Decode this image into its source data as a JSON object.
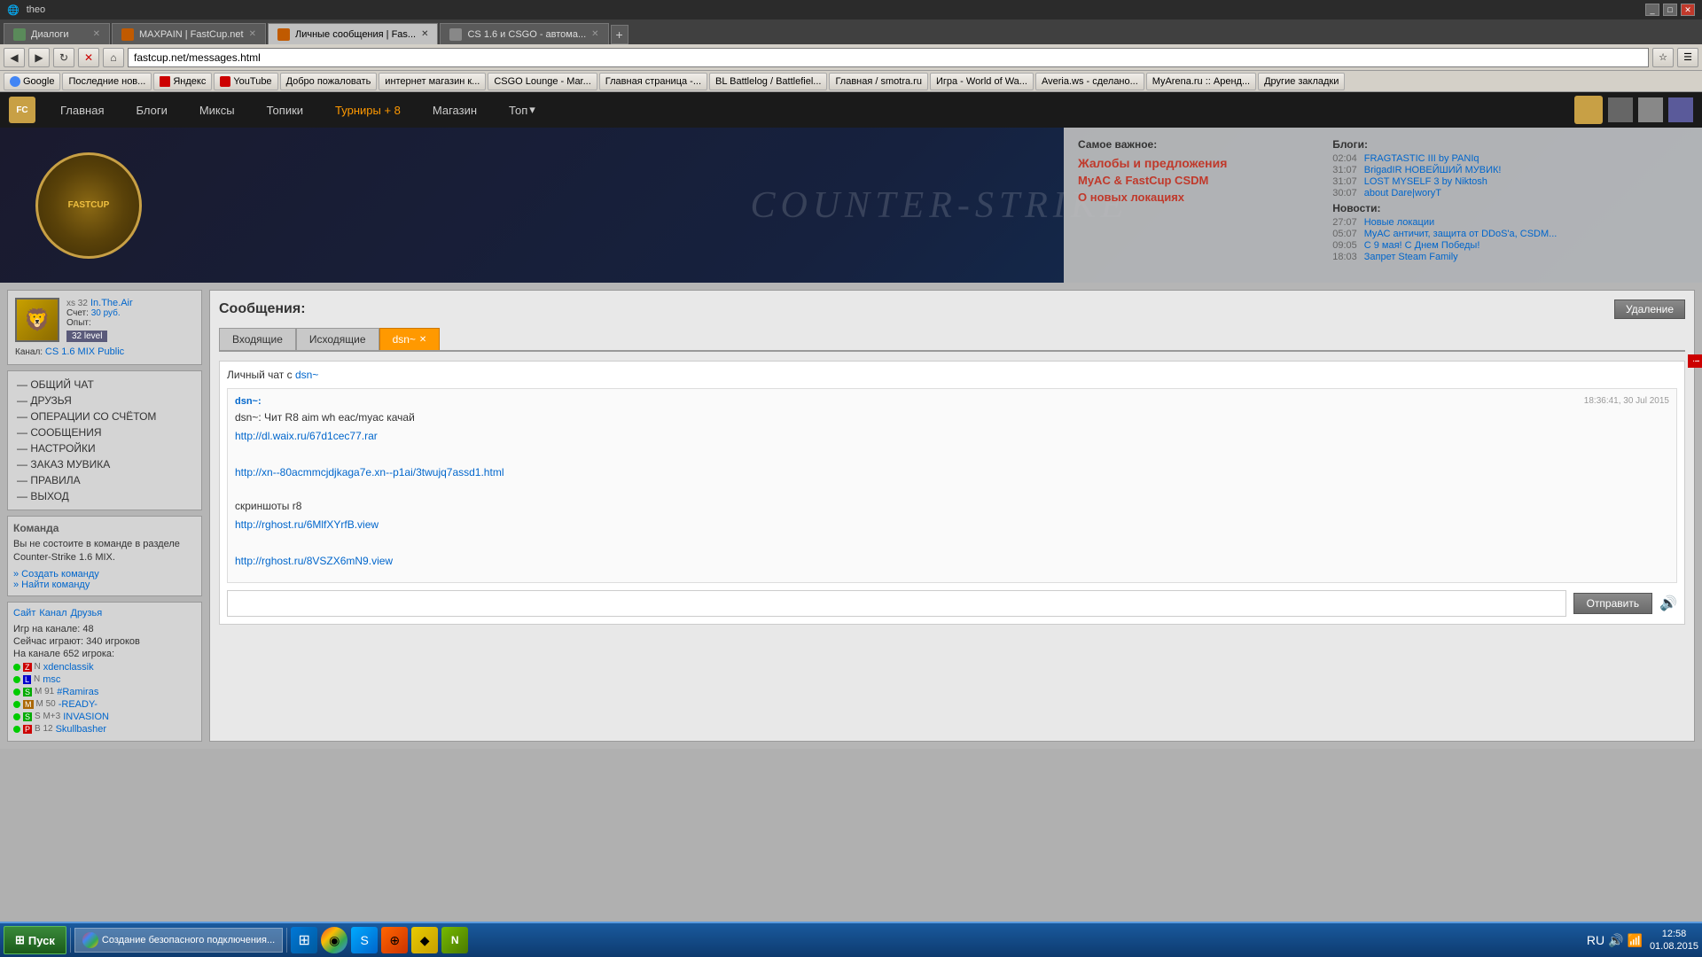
{
  "browser": {
    "title": "theo",
    "tabs": [
      {
        "id": "tab1",
        "label": "Диалоги",
        "active": false,
        "favicon": "💬"
      },
      {
        "id": "tab2",
        "label": "MAXPAIN | FastCup.net",
        "active": false,
        "favicon": "🎮"
      },
      {
        "id": "tab3",
        "label": "Личные сообщения | Fas...",
        "active": true,
        "favicon": "✉"
      },
      {
        "id": "tab4",
        "label": "CS 1.6 и CSGO - автома...",
        "active": false,
        "favicon": "🎯"
      }
    ],
    "address": "fastcup.net/messages.html",
    "bookmarks": [
      {
        "label": "Google"
      },
      {
        "label": "Последние нов..."
      },
      {
        "label": "Яндекс"
      },
      {
        "label": "YouTube"
      },
      {
        "label": "Добро пожаловать"
      },
      {
        "label": "интернет магазин к..."
      },
      {
        "label": "CSGO Lounge - Mar..."
      },
      {
        "label": "Главная страница -..."
      },
      {
        "label": "BL  Battlelog / Battlefiel..."
      },
      {
        "label": "Главная / smotra.ru"
      },
      {
        "label": "Игра - World of Wa..."
      },
      {
        "label": "Averia.ws - сделано..."
      },
      {
        "label": "MyArena.ru :: Аренд..."
      },
      {
        "label": "Другие закладки"
      }
    ]
  },
  "site": {
    "nav": {
      "items": [
        {
          "label": "Главная"
        },
        {
          "label": "Блоги"
        },
        {
          "label": "Миксы"
        },
        {
          "label": "Топики"
        },
        {
          "label": "Турниры + 8"
        },
        {
          "label": "Магазин"
        },
        {
          "label": "Топ"
        }
      ]
    },
    "banner": {
      "title": "Counter-Strike",
      "logo_text": "FASTCUP"
    },
    "important": {
      "title": "Самое важное:",
      "links": [
        {
          "label": "Жалобы и предложения"
        },
        {
          "label": "MyAC & FastCup CSDM"
        },
        {
          "label": "О новых локациях"
        }
      ]
    },
    "blogs": {
      "title": "Блоги:",
      "items": [
        {
          "time": "02:04",
          "label": "FRAGTASTIC III by PANIq"
        },
        {
          "time": "31:07",
          "label": "BrigadIR НОВЕЙШИЙ МУВИК!"
        },
        {
          "time": "31:07",
          "label": "LOST MYSELF 3 by Niktosh"
        },
        {
          "time": "30:07",
          "label": "about Dare|woryT"
        }
      ]
    },
    "news": {
      "title": "Новости:",
      "items": [
        {
          "time": "27:07",
          "label": "Новые локации"
        },
        {
          "time": "05:07",
          "label": "MyАС античит, защита от DDoS'а, CSDM..."
        },
        {
          "time": "09:05",
          "label": "С 9 мая! С Днем Победы!"
        },
        {
          "time": "18:03",
          "label": "Запрет Steam Family"
        }
      ]
    }
  },
  "sidebar": {
    "user": {
      "name": "In.The.Air",
      "prefix": "xs 32",
      "score": "30 руб.",
      "exp_label": "Опыт:",
      "level": "32 level",
      "channel_label": "Канал:",
      "channel": "CS 1.6 MIX Public"
    },
    "menu_items": [
      {
        "label": "— ОБЩИЙ ЧАТ"
      },
      {
        "label": "— ДРУЗЬЯ"
      },
      {
        "label": "— ОПЕРАЦИИ СО СЧЁТОМ"
      },
      {
        "label": "— СООБЩЕНИЯ"
      },
      {
        "label": "— НАСТРОЙКИ"
      },
      {
        "label": "— ЗАКАЗ МУВИКА"
      },
      {
        "label": "— ПРАВИЛА"
      },
      {
        "label": "— ВЫХОД"
      }
    ],
    "team": {
      "title": "Команда",
      "text": "Вы не состоите в команде в разделе Counter-Strike 1.6 MIX.",
      "create_link": "» Создать команду",
      "find_link": "» Найти команду"
    },
    "channel": {
      "tabs": [
        "Сайт",
        "Канал",
        "Друзья"
      ],
      "stats": [
        {
          "label": "Игр на канале: 48"
        },
        {
          "label": "Сейчас играют: 340 игроков"
        },
        {
          "label": "На канале 652 игрока:"
        }
      ],
      "players": [
        {
          "rank": "Z",
          "rank_class": "rank-z",
          "prefix": "N",
          "name": "xdenclassik"
        },
        {
          "rank": "L",
          "rank_class": "rank-l",
          "prefix": "N",
          "name": "msc"
        },
        {
          "rank": "S",
          "rank_class": "rank-s",
          "prefix": "M 91",
          "name": "#Ramiras"
        },
        {
          "rank": "M",
          "rank_class": "rank-m",
          "prefix": "M 50",
          "name": "-READY-"
        },
        {
          "rank": "S",
          "rank_class": "rank-s",
          "prefix": "S M+3",
          "name": "INVASION"
        },
        {
          "rank": "P",
          "rank_class": "rank-p",
          "prefix": "B 12",
          "name": "Skullbasher"
        }
      ]
    }
  },
  "messages": {
    "page_title": "Сообщения:",
    "delete_btn": "Удаление",
    "tabs": [
      {
        "label": "Входящие",
        "active": false
      },
      {
        "label": "Исходящие",
        "active": false
      },
      {
        "label": "dsn~",
        "active": true,
        "closeable": true
      }
    ],
    "chat_title_prefix": "Личный чат с",
    "chat_user": "dsn~",
    "messages": [
      {
        "sender": "dsn~:",
        "text": "dsn~: Чит R8 aim wh eac/myac качай",
        "timestamp": "18:36:41, 30 Jul 2015",
        "links": [
          "http://dl.waix.ru/67d1cec77.rar",
          "http://xn--80acmmcjdjkaga7e.xn--p1ai/3twujq7assd1.html",
          "",
          "скриншоты r8",
          "",
          "http://rghost.ru/6MlfXYrfB.view",
          "",
          "http://rghost.ru/8VSZX6mN9.view"
        ]
      }
    ],
    "input_placeholder": "",
    "send_btn": "Отправить"
  },
  "taskbar": {
    "start_label": "Пуск",
    "items": [
      {
        "label": "Создание безопасного подключения...",
        "icon_color": "#4a90d9"
      }
    ],
    "apps": [
      {
        "icon": "⊞",
        "color": "#0078d7"
      },
      {
        "icon": "◉",
        "color": "#f4900c"
      },
      {
        "icon": "S",
        "color": "#00aaff"
      },
      {
        "icon": "⊕",
        "color": "#ff6600"
      },
      {
        "icon": "◆",
        "color": "#e8ca00"
      },
      {
        "icon": "N",
        "color": "#76b900"
      }
    ],
    "lang": "RU",
    "time": "12:58",
    "date": "01.08.2015",
    "status_bar_text": "Создание безопасного подключения..."
  }
}
